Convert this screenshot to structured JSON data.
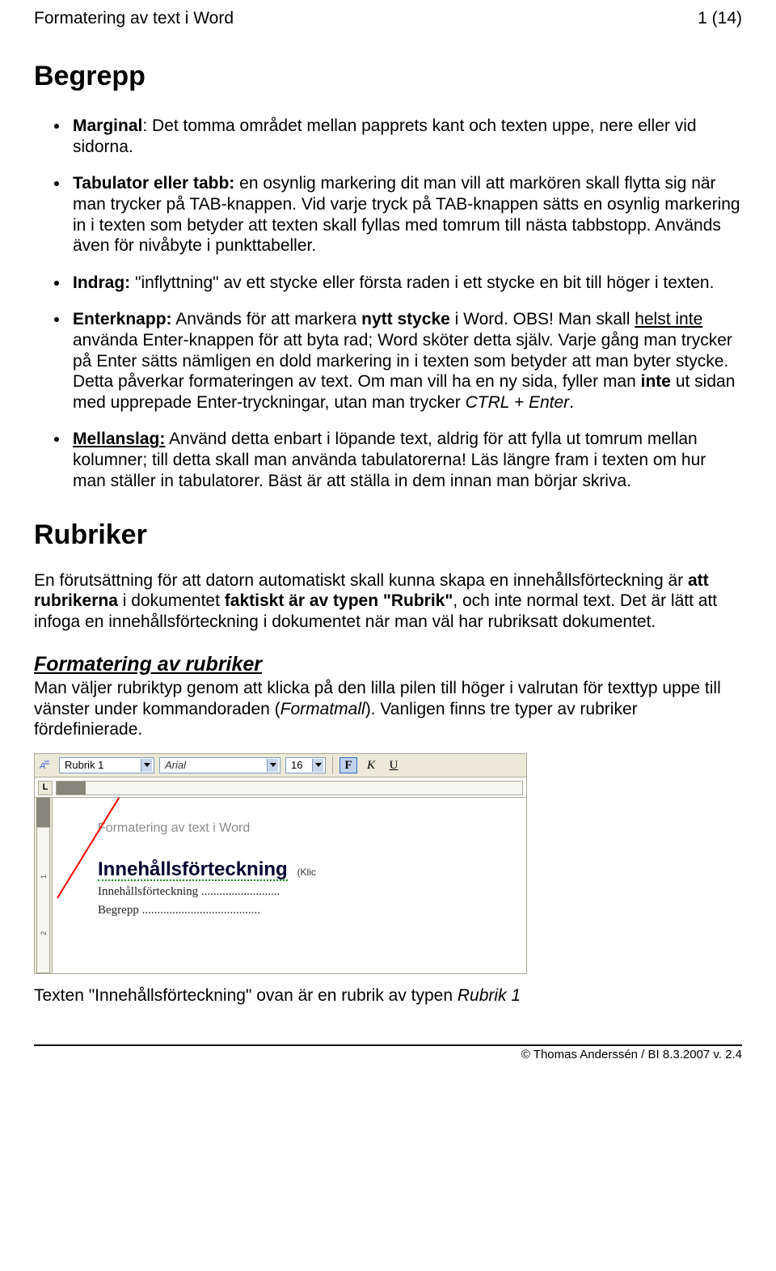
{
  "header": {
    "left": "Formatering av text i Word",
    "right": "1 (14)"
  },
  "h_begrepp": "Begrepp",
  "bullets": {
    "b1_term": "Marginal",
    "b1_rest": ": Det tomma området mellan papprets kant och texten uppe, nere eller vid sidorna.",
    "b2_term": "Tabulator eller tabb:",
    "b2_body": " en osynlig markering dit man vill att markören skall flytta sig när man trycker på TAB-knappen. Vid varje tryck på TAB-knappen sätts en osynlig markering in i texten som betyder att texten skall fyllas med tomrum till nästa tabbstopp. Används även för nivåbyte i punkttabeller.",
    "b3_term": "Indrag:",
    "b3_body": " \"inflyttning\" av ett stycke eller första raden i ett stycke en bit till höger i texten.",
    "b4_term": "Enterknapp:",
    "b4_a": " Används för att markera ",
    "b4_nytt": "nytt stycke",
    "b4_b": " i Word. OBS! Man skall ",
    "b4_helst": "helst inte",
    "b4_c": " använda Enter-knappen för att byta rad; Word sköter detta själv. Varje gång man trycker på Enter sätts nämligen en dold markering in i texten som betyder att man byter stycke. Detta påverkar formateringen av text. Om man vill ha en ny sida, fyller man ",
    "b4_inte": "inte",
    "b4_d": " ut sidan med upprepade Enter-tryckningar, utan man trycker ",
    "b4_ctrl": "CTRL + Enter",
    "b4_e": ".",
    "b5_term": "Mellanslag:",
    "b5_body": " Använd detta enbart i löpande text, aldrig för att fylla ut tomrum mellan kolumner; till detta skall man använda tabulatorerna! Läs längre fram i texten om hur man ställer in tabulatorer. Bäst är att ställa in dem innan man börjar skriva."
  },
  "h_rubriker": "Rubriker",
  "para_rubriker_a": "En förutsättning för att datorn automatiskt skall kunna skapa en innehållsförteckning  är ",
  "para_rubriker_b": "att rubrikerna",
  "para_rubriker_c": "  i dokumentet ",
  "para_rubriker_d": "faktiskt är av typen \"Rubrik\"",
  "para_rubriker_e": ", och inte normal text.  Det är lätt att infoga en innehållsförteckning i dokumentet när man väl har rubriksatt dokumentet.",
  "h_formatering": "Formatering av rubriker",
  "para_format_a": "Man väljer rubriktyp genom att klicka på den lilla pilen till höger i valrutan för texttyp uppe till vänster under kommandoraden (",
  "para_format_b": "Formatmall",
  "para_format_c": "). Vanligen finns tre typer av rubriker fördefinierade.",
  "toolbar": {
    "style": "Rubrik 1",
    "font": "Arial",
    "size": "16",
    "bold": "F",
    "italic": "K",
    "underline": "U",
    "ruler_btn": "L"
  },
  "doc": {
    "title": "Formatering av text i Word",
    "h1": "Innehållsförteckning",
    "klic": "(Klic",
    "line1": "Innehållsförteckning ..........................",
    "line2": "Begrepp ......................................."
  },
  "caption_a": "Texten \"Innehållsförteckning\" ovan är en rubrik av typen ",
  "caption_b": "Rubrik 1",
  "footer": "© Thomas Anderssén / BI 8.3.2007 v. 2.4"
}
